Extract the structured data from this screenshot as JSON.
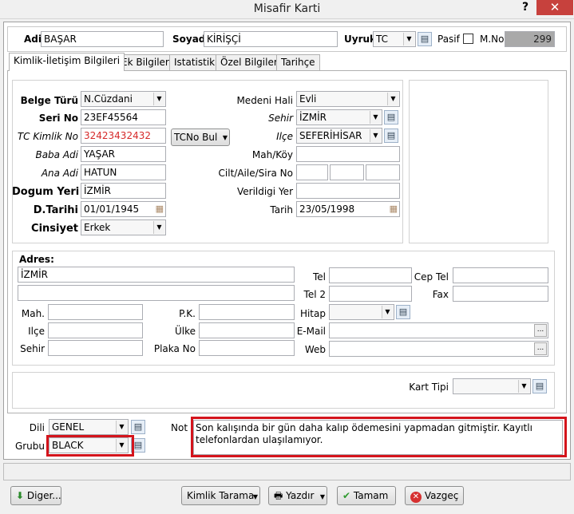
{
  "window": {
    "title": "Misafir Karti",
    "help": "?",
    "close": "✕"
  },
  "header": {
    "adi_label": "Adi",
    "adi_value": "BAŞAR",
    "soyadi_label": "Soyadi",
    "soyadi_value": "KİRİŞÇİ",
    "uyruk_label": "Uyruk",
    "uyruk_value": "TC",
    "pasif_label": "Pasif",
    "pasif_checked": false,
    "mno_label": "M.No",
    "mno_value": "299"
  },
  "tabs": [
    "Kimlik-İletişim Bilgileri",
    "Ek Bilgiler",
    "Istatistik",
    "Özel Bilgiler",
    "Tarihçe"
  ],
  "identity": {
    "belge_turu_label": "Belge Türü",
    "belge_turu_value": "N.Cüzdani",
    "seri_no_label": "Seri No",
    "seri_no_value": "23EF45564",
    "tc_kimlik_label": "TC Kimlik No",
    "tc_kimlik_value": "32423432432",
    "tcno_bul_label": "TCNo Bul",
    "baba_adi_label": "Baba Adi",
    "baba_adi_value": "YAŞAR",
    "ana_adi_label": "Ana Adi",
    "ana_adi_value": "HATUN",
    "dogum_yeri_label": "Dogum Yeri",
    "dogum_yeri_value": "İZMİR",
    "dtarihi_label": "D.Tarihi",
    "dtarihi_value": "01/01/1945",
    "cinsiyet_label": "Cinsiyet",
    "cinsiyet_value": "Erkek",
    "medeni_hali_label": "Medeni Hali",
    "medeni_hali_value": "Evli",
    "sehir_label": "Sehir",
    "sehir_value": "İZMİR",
    "ilce_label": "Ilçe",
    "ilce_value": "SEFERİHİSAR",
    "mahkoy_label": "Mah/Köy",
    "mahkoy_value": "",
    "cilt_label": "Cilt/Aile/Sira No",
    "verildigi_yer_label": "Verildigi Yer",
    "verildigi_yer_value": "",
    "tarih_label": "Tarih",
    "tarih_value": "23/05/1998"
  },
  "address": {
    "adres_label": "Adres:",
    "adres_line1": "İZMİR",
    "adres_line2": "",
    "mah_label": "Mah.",
    "ilce_label": "Ilçe",
    "sehir_label": "Sehir",
    "pk_label": "P.K.",
    "ulke_label": "Ülke",
    "plaka_label": "Plaka No",
    "tel_label": "Tel",
    "tel2_label": "Tel 2",
    "hitap_label": "Hitap",
    "email_label": "E-Mail",
    "web_label": "Web",
    "ceptel_label": "Cep Tel",
    "fax_label": "Fax",
    "ellipsis": "..."
  },
  "kart_tipi_label": "Kart Tipi",
  "bottom": {
    "dili_label": "Dili",
    "dili_value": "GENEL",
    "grubu_label": "Grubu",
    "grubu_value": "BLACK",
    "not_label": "Not",
    "not_value": "Son kalışında bir gün daha kalıp ödemesini yapmadan gitmiştir. Kayıtlı telefonlardan ulaşılamıyor."
  },
  "buttons": {
    "diger": "Diger...",
    "kimlik_tarama": "Kimlik Tarama",
    "yazdir": "Yazdır",
    "tamam": "Tamam",
    "vazgec": "Vazgeç"
  },
  "colors": {
    "highlight": "#d4141c",
    "tc_text": "#d62a2a",
    "title_close": "#c7413d"
  }
}
